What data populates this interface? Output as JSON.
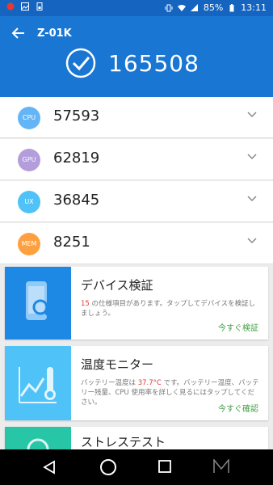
{
  "status_bar": {
    "battery": "85%",
    "time": "13:11"
  },
  "header": {
    "device_name": "Z-01K",
    "total_score": "165508"
  },
  "scores": [
    {
      "badge": "CPU",
      "value": "57593",
      "color": "#64b5f6"
    },
    {
      "badge": "GPU",
      "value": "62819",
      "color": "#b39ddb"
    },
    {
      "badge": "UX",
      "value": "36845",
      "color": "#4fc3f7"
    },
    {
      "badge": "MEM",
      "value": "8251",
      "color": "#ffa040"
    }
  ],
  "cards": [
    {
      "title": "デバイス検証",
      "desc_prefix": "15",
      "desc_rest": " の仕様項目があります。タップしてデバイスを検証しましょう。",
      "action": "今すぐ検証",
      "thumb_color": "#1e88e5",
      "icon": "phone-search-icon"
    },
    {
      "title": "温度モニター",
      "desc_a": "バッテリー温度は ",
      "desc_temp": "37.7°C",
      "desc_b": " です。バッテリー温度、バッテリー残量、CPU 使用率を詳しく見るにはタップしてください。",
      "action": "今すぐ確認",
      "thumb_color": "#4fc3f7",
      "icon": "thermometer-chart-icon"
    },
    {
      "title": "ストレステスト",
      "thumb_color": "#26c6a6",
      "icon": "stress-test-icon"
    }
  ],
  "colors": {
    "header": "#1976d2",
    "status_bar": "#1565c0",
    "accent_green": "#43a047"
  }
}
